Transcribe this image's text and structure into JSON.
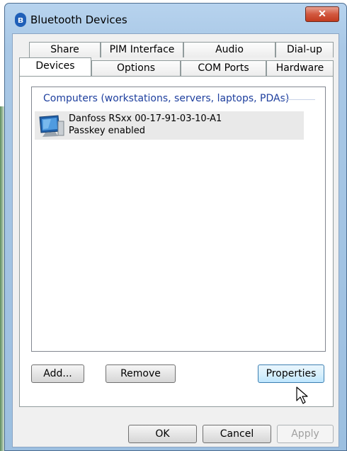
{
  "window": {
    "title": "Bluetooth Devices",
    "close_glyph": "✕",
    "bluetooth_glyph": "ʙ"
  },
  "tabs": {
    "row1": [
      "Share",
      "PIM Interface",
      "Audio",
      "Dial-up"
    ],
    "row2": [
      "Devices",
      "Options",
      "COM Ports",
      "Hardware"
    ],
    "active": "Devices"
  },
  "devices_list": {
    "group_header": "Computers (workstations, servers, laptops, PDAs)",
    "items": [
      {
        "name": "Danfoss RSxx 00-17-91-03-10-A1",
        "status": "Passkey enabled",
        "icon": "computer-monitor-icon"
      }
    ]
  },
  "buttons": {
    "add": "Add...",
    "remove": "Remove",
    "properties": "Properties",
    "ok": "OK",
    "cancel": "Cancel",
    "apply": "Apply"
  },
  "colors": {
    "group_header": "#1e3f9e",
    "titlebar": "#b7d3ee",
    "close_button": "#c23b1f"
  }
}
